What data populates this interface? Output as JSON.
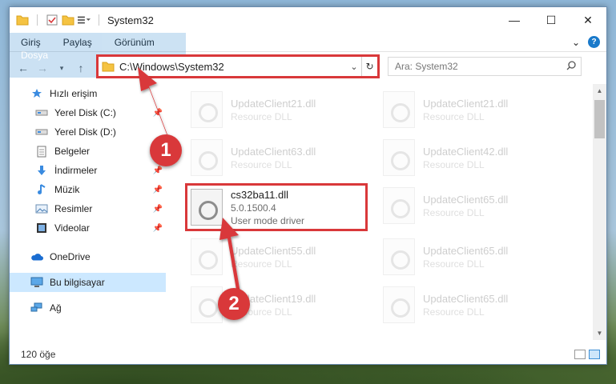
{
  "window": {
    "title": "System32"
  },
  "ribbon": {
    "tabs": [
      {
        "label": "Dosya",
        "active": true
      },
      {
        "label": "Giriş"
      },
      {
        "label": "Paylaş"
      },
      {
        "label": "Görünüm"
      }
    ]
  },
  "address": {
    "path": "C:\\Windows\\System32"
  },
  "search": {
    "placeholder": "Ara: System32"
  },
  "sidebar": {
    "items": [
      {
        "label": "Hızlı erişim",
        "icon": "star-icon"
      },
      {
        "label": "Yerel Disk (C:)",
        "icon": "drive-icon",
        "pinned": true
      },
      {
        "label": "Yerel Disk (D:)",
        "icon": "drive-icon"
      },
      {
        "label": "Belgeler",
        "icon": "document-icon"
      },
      {
        "label": "İndirmeler",
        "icon": "download-icon",
        "pinned": true
      },
      {
        "label": "Müzik",
        "icon": "music-icon",
        "pinned": true
      },
      {
        "label": "Resimler",
        "icon": "pictures-icon",
        "pinned": true
      },
      {
        "label": "Videolar",
        "icon": "video-icon",
        "pinned": true
      },
      {
        "label": "OneDrive",
        "icon": "cloud-icon"
      },
      {
        "label": "Bu bilgisayar",
        "icon": "computer-icon",
        "selected": true
      },
      {
        "label": "Ağ",
        "icon": "network-icon"
      }
    ]
  },
  "files": [
    {
      "name": "UpdateClient21.dll",
      "type": "Resource DLL"
    },
    {
      "name": "UpdateClient21.dll",
      "type": "Resource DLL"
    },
    {
      "name": "UpdateClient63.dll",
      "type": "Resource DLL"
    },
    {
      "name": "UpdateClient42.dll",
      "type": "Resource DLL"
    },
    {
      "name": "cs32ba11.dll",
      "version": "5.0.1500.4",
      "type": "User mode driver",
      "highlighted": true
    },
    {
      "name": "UpdateClient65.dll",
      "type": "Resource DLL"
    },
    {
      "name": "UpdateClient55.dll",
      "type": "Resource DLL"
    },
    {
      "name": "UpdateClient65.dll",
      "type": "Resource DLL"
    },
    {
      "name": "UpdateClient19.dll",
      "type": "Resource DLL"
    },
    {
      "name": "UpdateClient65.dll",
      "type": "Resource DLL"
    }
  ],
  "status": {
    "count": "120 öğe"
  },
  "annotations": {
    "badge1": "1",
    "badge2": "2",
    "color": "#d9383a"
  }
}
